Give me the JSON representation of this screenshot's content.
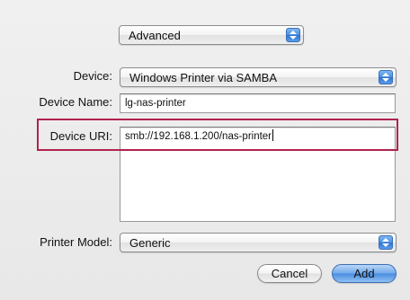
{
  "mode_popup": {
    "value": "Advanced"
  },
  "device": {
    "label": "Device:",
    "value": "Windows Printer via SAMBA"
  },
  "device_name": {
    "label": "Device Name:",
    "value": "lg-nas-printer"
  },
  "device_uri": {
    "label": "Device URI:",
    "value": "smb://192.168.1.200/nas-printer"
  },
  "printer_model": {
    "label": "Printer Model:",
    "value": "Generic"
  },
  "buttons": {
    "cancel": "Cancel",
    "add": "Add"
  },
  "colors": {
    "highlight": "#b0234e",
    "accent": "#4a8ce0"
  }
}
